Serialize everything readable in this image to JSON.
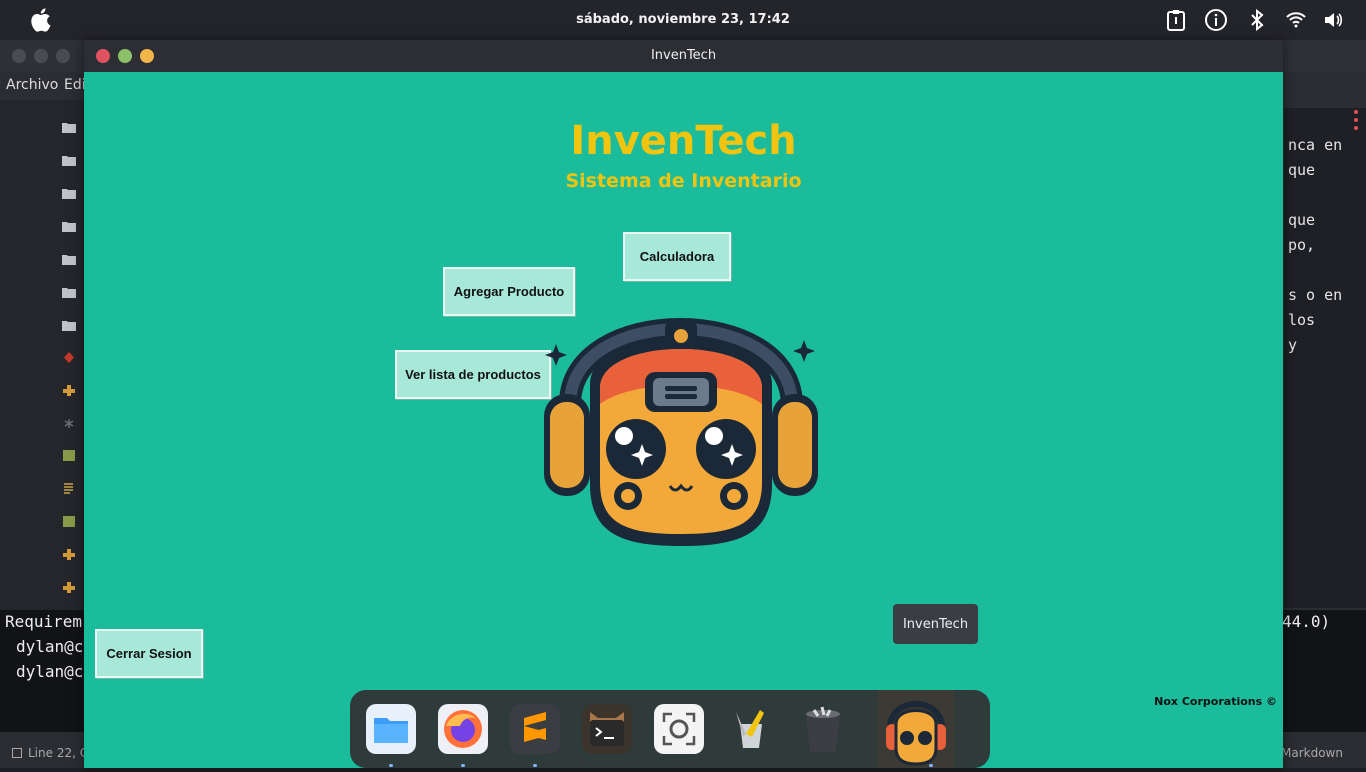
{
  "topbar": {
    "clock": "sábado, noviembre 23, 17:42",
    "icons": [
      "apple-icon",
      "clipboard-icon",
      "info-icon",
      "bluetooth-icon",
      "wifi-icon",
      "volume-icon"
    ]
  },
  "background_window": {
    "menu": [
      "Archivo",
      "Edi"
    ],
    "right_text": [
      "nca en",
      "que",
      "",
      "que",
      "po,",
      "",
      "s o en",
      "los",
      "y"
    ],
    "terminal_lines": [
      "Requirem",
      "dylan@c",
      "dylan@c"
    ],
    "terminal_right": "44.0)",
    "status_left": "Line 22, C",
    "status_right": "Markdown"
  },
  "app": {
    "window_title": "InvenTech",
    "title": "InvenTech",
    "subtitle": "Sistema de Inventario",
    "buttons": {
      "calculadora": "Calculadora",
      "agregar": "Agregar Producto",
      "ver_lista": "Ver lista de productos",
      "cerrar": "Cerrar Sesion"
    },
    "footer": "Nox Corporations ©",
    "tooltip": "InvenTech"
  },
  "dock": {
    "items": [
      "files-icon",
      "firefox-icon",
      "sublime-text-icon",
      "terminal-icon",
      "screenshot-icon",
      "text-editor-icon",
      "trash-icon",
      "inventech-app-icon"
    ]
  },
  "colors": {
    "app_bg": "#1abc9c",
    "title": "#f1c40f",
    "button_bg": "#a7e8d8"
  }
}
